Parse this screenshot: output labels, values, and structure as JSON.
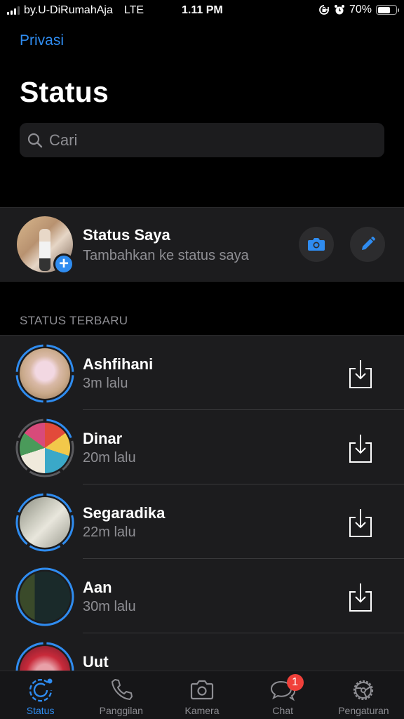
{
  "status_bar": {
    "carrier": "by.U-DiRumahAja",
    "network": "LTE",
    "time": "1.11 PM",
    "battery_percent_label": "70%",
    "battery_level": 0.7,
    "icons": [
      "signal-icon",
      "orientation-lock-icon",
      "alarm-icon",
      "battery-icon"
    ]
  },
  "header": {
    "privacy_link": "Privasi",
    "title": "Status",
    "search_placeholder": "Cari"
  },
  "my_status": {
    "name": "Status Saya",
    "subtitle": "Tambahkan ke status saya",
    "actions": [
      "camera-icon",
      "pencil-icon"
    ]
  },
  "recent": {
    "section_label": "STATUS TERBARU",
    "items": [
      {
        "name": "Ashfihani",
        "time": "3m lalu",
        "segments": 4,
        "viewed_segments": 0
      },
      {
        "name": "Dinar",
        "time": "20m lalu",
        "segments": 5,
        "viewed_segments": 4
      },
      {
        "name": "Segaradika",
        "time": "22m lalu",
        "segments": 5,
        "viewed_segments": 0
      },
      {
        "name": "Aan",
        "time": "30m lalu",
        "segments": 1,
        "viewed_segments": 0
      },
      {
        "name": "Uut",
        "time": "",
        "segments": 3,
        "viewed_segments": 0
      }
    ]
  },
  "tabbar": {
    "tabs": [
      {
        "label": "Status",
        "icon": "status-icon",
        "active": true
      },
      {
        "label": "Panggilan",
        "icon": "phone-icon",
        "active": false
      },
      {
        "label": "Kamera",
        "icon": "camera-icon",
        "active": false
      },
      {
        "label": "Chat",
        "icon": "chat-icon",
        "active": false,
        "badge": "1"
      },
      {
        "label": "Pengaturan",
        "icon": "settings-icon",
        "active": false
      }
    ]
  },
  "colors": {
    "accent": "#2f8cf0",
    "unviewed_ring": "#2f8cf0",
    "viewed_ring": "#5a5a5e",
    "badge": "#f0403a",
    "background": "#000000",
    "cell": "#1c1c1e"
  }
}
